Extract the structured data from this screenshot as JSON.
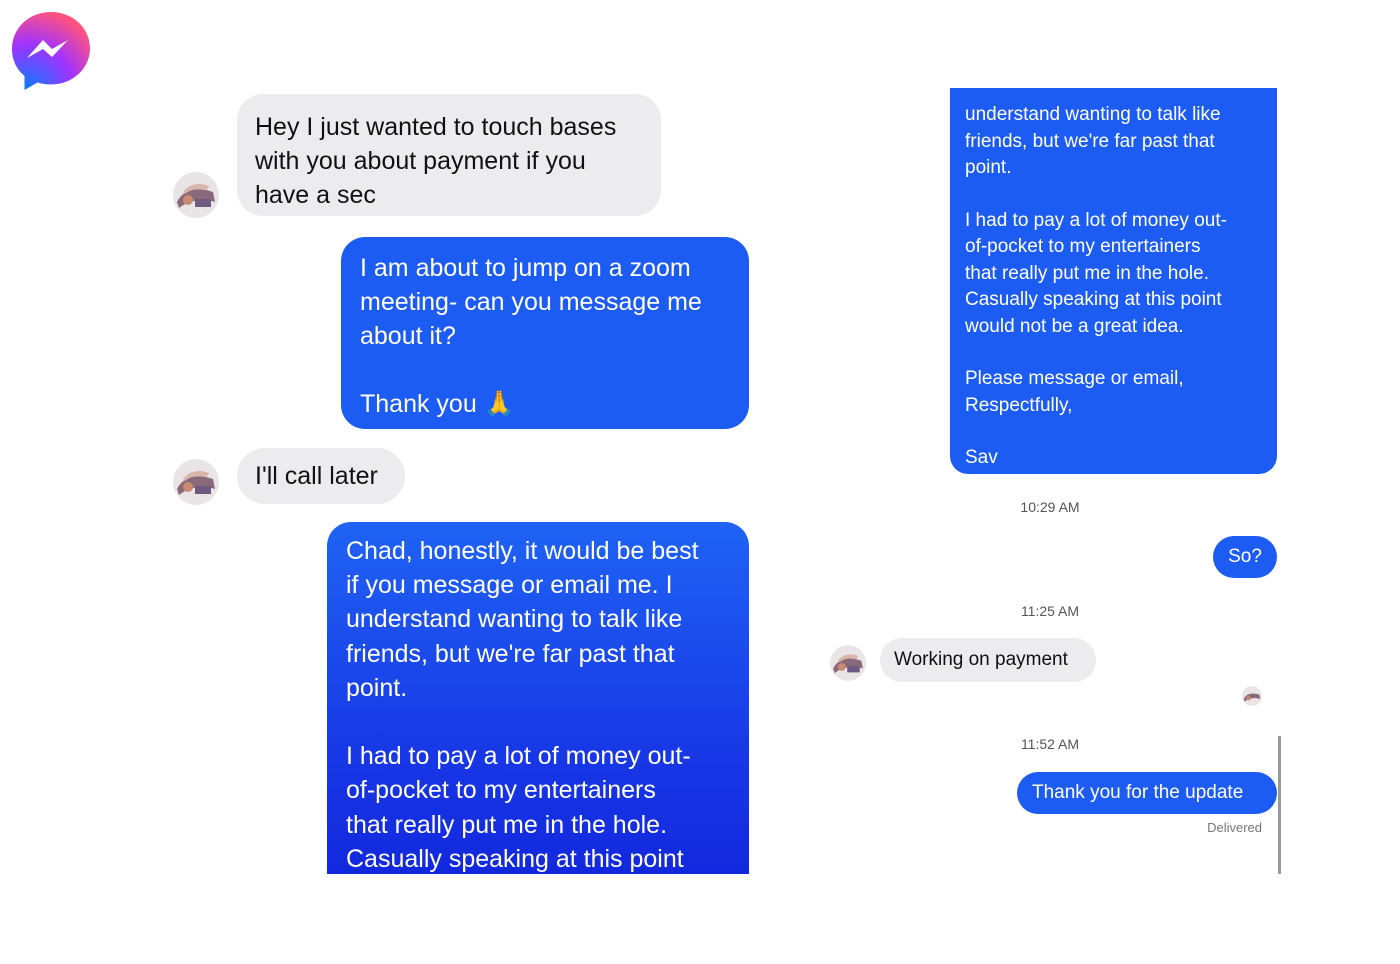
{
  "app": {
    "name": "Messenger",
    "logo_icon": "messenger-logo-icon",
    "colors": {
      "sent_bubble": "#1d5cf2",
      "received_bubble": "#ececef",
      "logo_gradient_start": "#0a7cff",
      "logo_gradient_mid": "#a033ff",
      "logo_gradient_end": "#ff5280"
    }
  },
  "left_screenshot": {
    "messages": [
      {
        "sender": "them",
        "lines": [
          "Hey I just wanted to touch bases",
          "with you about payment if you",
          "have a sec"
        ]
      },
      {
        "sender": "me",
        "lines": [
          "I am about to jump on a zoom",
          "meeting- can you message me",
          "about it?",
          "",
          "Thank you 🙏"
        ]
      },
      {
        "sender": "them",
        "lines": [
          "I'll call later"
        ]
      },
      {
        "sender": "me",
        "lines": [
          "Chad, honestly, it would be best",
          "if you message or email me. I",
          "understand wanting to talk like",
          "friends, but we're far past that",
          "point.",
          "",
          "I had to pay a lot of money out-",
          "of-pocket to my entertainers",
          "that really put me in the hole.",
          "Casually speaking at this point"
        ]
      }
    ]
  },
  "right_screenshot": {
    "messages": [
      {
        "sender": "me",
        "lines": [
          "understand wanting to talk like",
          "friends, but we're far past that",
          "point.",
          "",
          "I had to pay a lot of money out-",
          "of-pocket to my entertainers",
          "that really put me in the hole.",
          "Casually speaking at this point",
          "would not be a great idea.",
          "",
          "Please message or email,",
          "Respectfully,",
          "",
          "Sav"
        ]
      },
      {
        "timestamp": "10:29 AM"
      },
      {
        "sender": "me",
        "text": "So?"
      },
      {
        "timestamp": "11:25 AM"
      },
      {
        "sender": "them",
        "text": "Working on payment"
      },
      {
        "timestamp": "11:52 AM"
      },
      {
        "sender": "me",
        "text": "Thank you for the update",
        "status": "Delivered"
      }
    ]
  }
}
